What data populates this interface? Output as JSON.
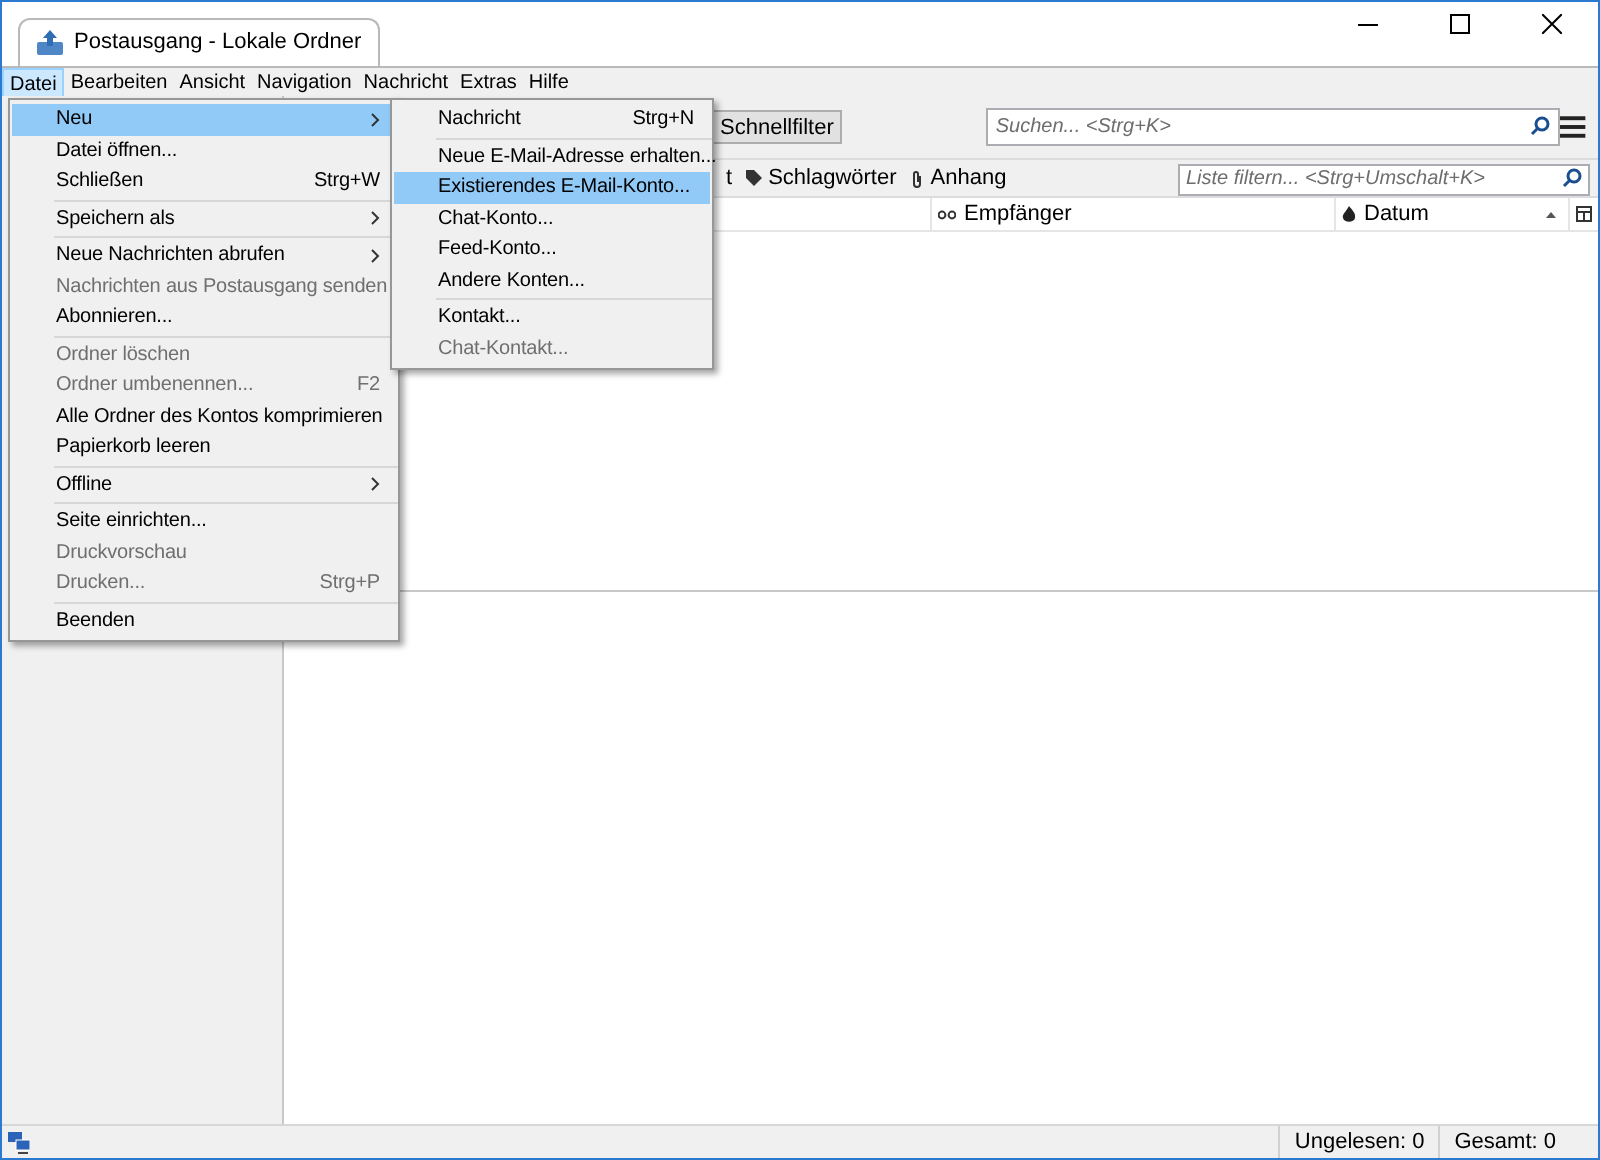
{
  "window": {
    "tab_title": "Postausgang - Lokale Ordner"
  },
  "menubar": [
    {
      "label": "Datei",
      "selected": true
    },
    {
      "label": "Bearbeiten",
      "selected": false
    },
    {
      "label": "Ansicht",
      "selected": false
    },
    {
      "label": "Navigation",
      "selected": false
    },
    {
      "label": "Nachricht",
      "selected": false
    },
    {
      "label": "Extras",
      "selected": false
    },
    {
      "label": "Hilfe",
      "selected": false
    }
  ],
  "toolbar": {
    "quickfilter_button": "Schnellfilter",
    "search": {
      "placeholder": "Suchen... <Strg+K>"
    }
  },
  "filter_row": {
    "partial_text": "t",
    "tags_label": "Schlagwörter",
    "attachment_label": "Anhang",
    "filter": {
      "placeholder": "Liste filtern... <Strg+Umschalt+K>"
    }
  },
  "columns": [
    {
      "label": "Empfänger",
      "kind": "recipient"
    },
    {
      "label": "Datum",
      "kind": "date"
    }
  ],
  "file_menu": [
    {
      "kind": "item",
      "label": "Neu",
      "selected": true,
      "disabled": false,
      "submenu": true
    },
    {
      "kind": "item",
      "label": "Datei öffnen...",
      "selected": false,
      "disabled": false,
      "submenu": false
    },
    {
      "kind": "item",
      "label": "Schließen",
      "shortcut": "Strg+W",
      "selected": false,
      "disabled": false,
      "submenu": false
    },
    {
      "kind": "separator"
    },
    {
      "kind": "item",
      "label": "Speichern als",
      "selected": false,
      "disabled": false,
      "submenu": true
    },
    {
      "kind": "separator"
    },
    {
      "kind": "item",
      "label": "Neue Nachrichten abrufen",
      "selected": false,
      "disabled": false,
      "submenu": true
    },
    {
      "kind": "item",
      "label": "Nachrichten aus Postausgang senden",
      "selected": false,
      "disabled": true,
      "submenu": false
    },
    {
      "kind": "item",
      "label": "Abonnieren...",
      "selected": false,
      "disabled": false,
      "submenu": false
    },
    {
      "kind": "separator"
    },
    {
      "kind": "item",
      "label": "Ordner löschen",
      "selected": false,
      "disabled": true,
      "submenu": false
    },
    {
      "kind": "item",
      "label": "Ordner umbenennen...",
      "shortcut": "F2",
      "selected": false,
      "disabled": true,
      "submenu": false
    },
    {
      "kind": "item",
      "label": "Alle Ordner des Kontos komprimieren",
      "selected": false,
      "disabled": false,
      "submenu": false
    },
    {
      "kind": "item",
      "label": "Papierkorb leeren",
      "selected": false,
      "disabled": false,
      "submenu": false
    },
    {
      "kind": "separator"
    },
    {
      "kind": "item",
      "label": "Offline",
      "selected": false,
      "disabled": false,
      "submenu": true
    },
    {
      "kind": "separator"
    },
    {
      "kind": "item",
      "label": "Seite einrichten...",
      "selected": false,
      "disabled": false,
      "submenu": false
    },
    {
      "kind": "item",
      "label": "Druckvorschau",
      "selected": false,
      "disabled": true,
      "submenu": false
    },
    {
      "kind": "item",
      "label": "Drucken...",
      "shortcut": "Strg+P",
      "selected": false,
      "disabled": true,
      "submenu": false
    },
    {
      "kind": "separator"
    },
    {
      "kind": "item",
      "label": "Beenden",
      "selected": false,
      "disabled": false,
      "submenu": false
    }
  ],
  "new_submenu": [
    {
      "kind": "item",
      "label": "Nachricht",
      "shortcut": "Strg+N",
      "selected": false,
      "disabled": false
    },
    {
      "kind": "separator"
    },
    {
      "kind": "item",
      "label": "Neue E-Mail-Adresse erhalten...",
      "selected": false,
      "disabled": false
    },
    {
      "kind": "item",
      "label": "Existierendes E-Mail-Konto...",
      "selected": true,
      "disabled": false
    },
    {
      "kind": "item",
      "label": "Chat-Konto...",
      "selected": false,
      "disabled": false
    },
    {
      "kind": "item",
      "label": "Feed-Konto...",
      "selected": false,
      "disabled": false
    },
    {
      "kind": "item",
      "label": "Andere Konten...",
      "selected": false,
      "disabled": false
    },
    {
      "kind": "separator"
    },
    {
      "kind": "item",
      "label": "Kontakt...",
      "selected": false,
      "disabled": false
    },
    {
      "kind": "item",
      "label": "Chat-Kontakt...",
      "selected": false,
      "disabled": true
    }
  ],
  "status_bar": {
    "unread": "Ungelesen: 0",
    "total": "Gesamt: 0"
  }
}
